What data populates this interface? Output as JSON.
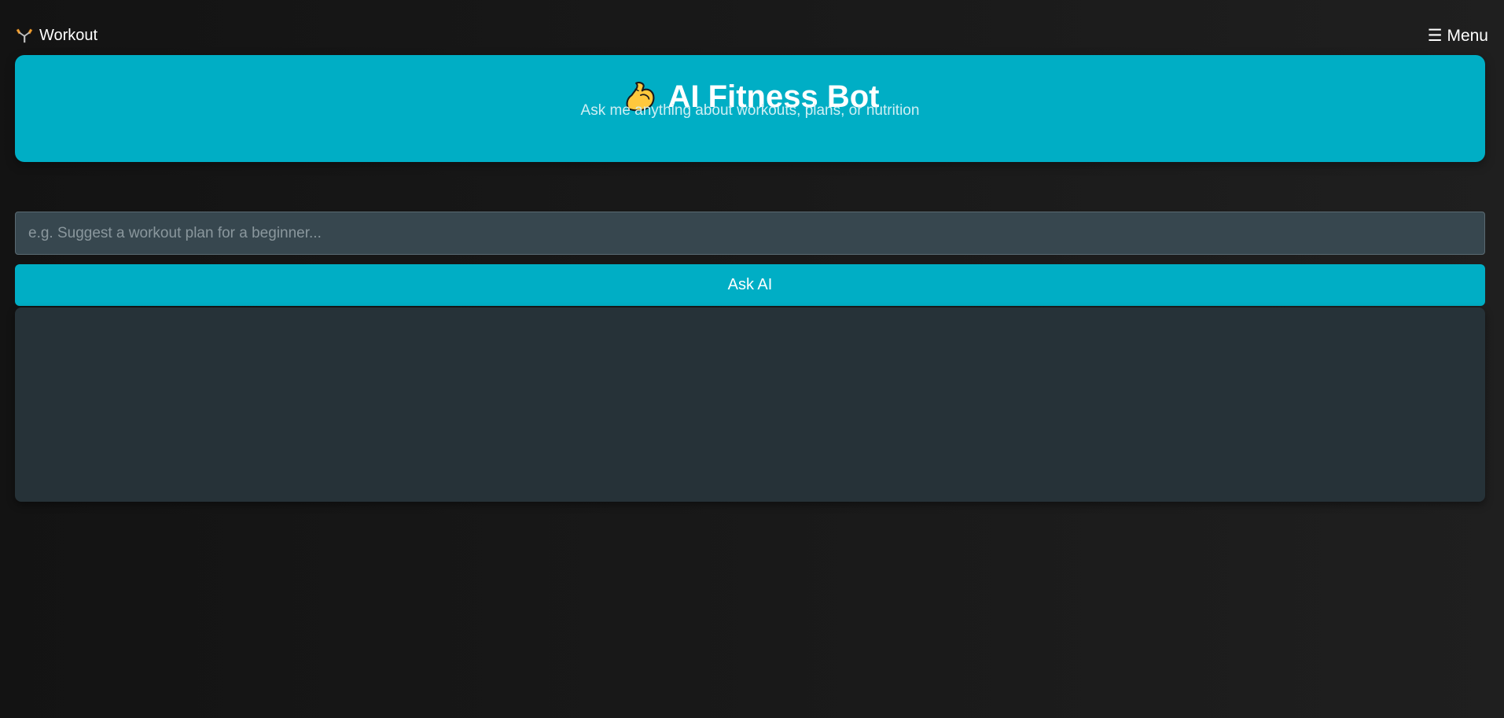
{
  "nav": {
    "brand_label": "Workout",
    "brand_icon": "dumbbell-icon",
    "menu_label": "☰ Menu"
  },
  "hero": {
    "title": "AI Fitness Bot",
    "title_icon": "flexed-biceps-icon",
    "subtitle": "Ask me anything about workouts, plans, or nutrition"
  },
  "query": {
    "value": "",
    "placeholder": "e.g. Suggest a workout plan for a beginner..."
  },
  "ask_button_label": "Ask AI",
  "response": {
    "text": ""
  },
  "colors": {
    "accent": "#00aec5",
    "input_bg": "#37474f",
    "response_bg": "#263238",
    "page_bg": "#161616"
  }
}
